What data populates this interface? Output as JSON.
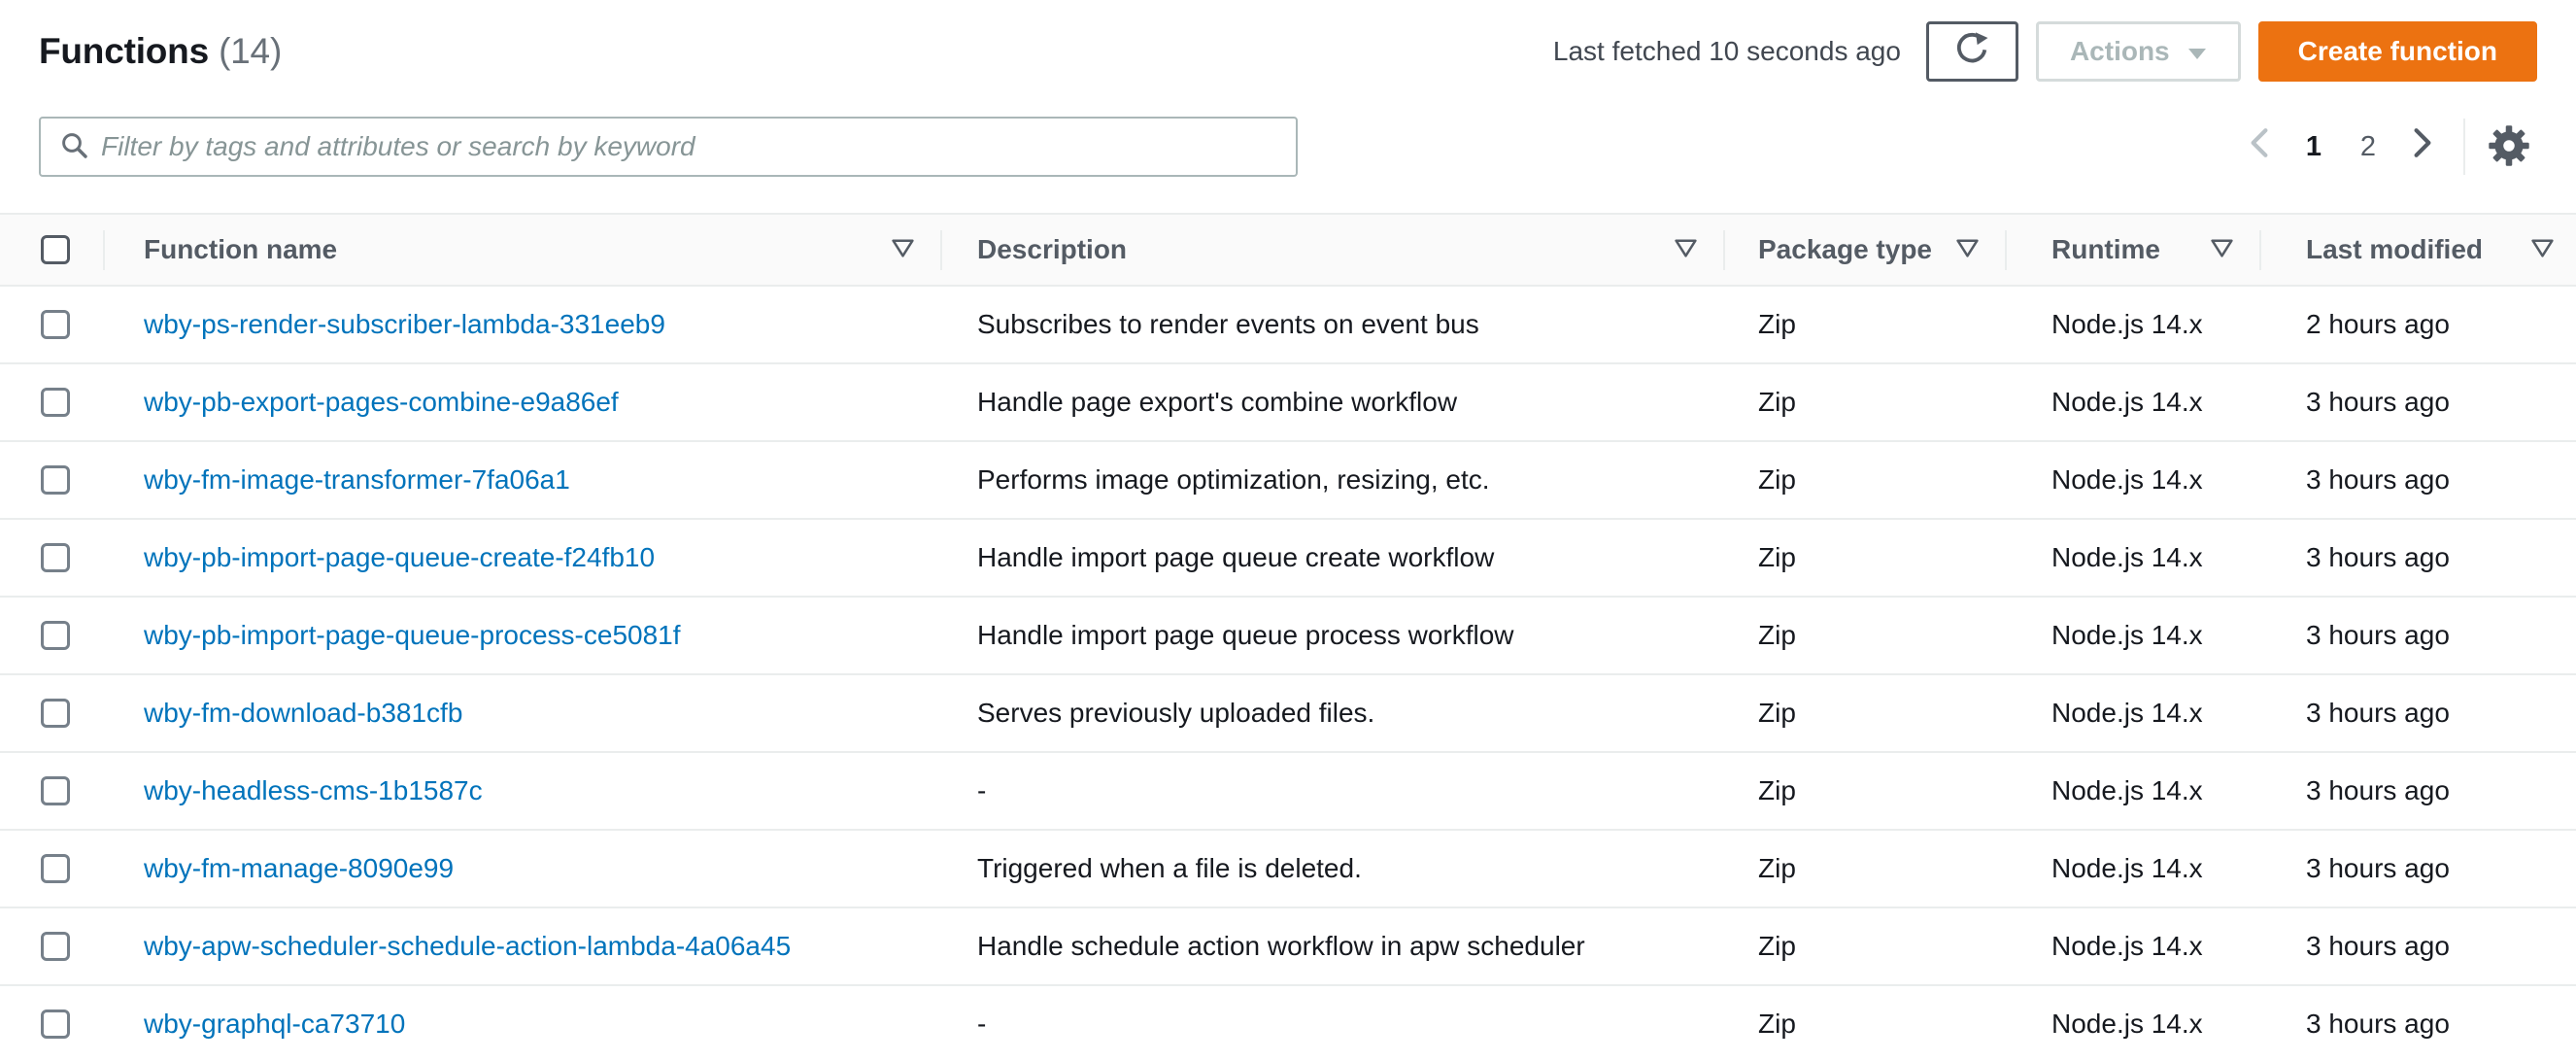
{
  "header": {
    "title": "Functions",
    "count": "(14)",
    "last_fetched": "Last fetched 10 seconds ago",
    "actions_label": "Actions",
    "create_label": "Create function"
  },
  "toolbar": {
    "search_placeholder": "Filter by tags and attributes or search by keyword",
    "pagination": {
      "prev_page": "‹",
      "page_1": "1",
      "page_2": "2",
      "next_page": "›",
      "current_page": "1"
    }
  },
  "icons": {
    "search": "magnifier",
    "refresh": "circular-arrow",
    "actions_caret": "caret-down-filled",
    "column_filter": "triangle-down-outline",
    "prev": "chevron-left",
    "next": "chevron-right",
    "settings": "gear"
  },
  "colors": {
    "accent_orange": "#ec7211",
    "link_blue": "#0073bb",
    "text_dark": "#16191f",
    "text_gray": "#687078",
    "header_text": "#545b64",
    "border_light": "#eaeded",
    "disabled_text": "#aab7b8"
  },
  "table": {
    "columns": [
      "Function name",
      "Description",
      "Package type",
      "Runtime",
      "Last modified"
    ],
    "rows": [
      {
        "name": "wby-ps-render-subscriber-lambda-331eeb9",
        "description": "Subscribes to render events on event bus",
        "package_type": "Zip",
        "runtime": "Node.js 14.x",
        "last_modified": "2 hours ago"
      },
      {
        "name": "wby-pb-export-pages-combine-e9a86ef",
        "description": "Handle page export's combine workflow",
        "package_type": "Zip",
        "runtime": "Node.js 14.x",
        "last_modified": "3 hours ago"
      },
      {
        "name": "wby-fm-image-transformer-7fa06a1",
        "description": "Performs image optimization, resizing, etc.",
        "package_type": "Zip",
        "runtime": "Node.js 14.x",
        "last_modified": "3 hours ago"
      },
      {
        "name": "wby-pb-import-page-queue-create-f24fb10",
        "description": "Handle import page queue create workflow",
        "package_type": "Zip",
        "runtime": "Node.js 14.x",
        "last_modified": "3 hours ago"
      },
      {
        "name": "wby-pb-import-page-queue-process-ce5081f",
        "description": "Handle import page queue process workflow",
        "package_type": "Zip",
        "runtime": "Node.js 14.x",
        "last_modified": "3 hours ago"
      },
      {
        "name": "wby-fm-download-b381cfb",
        "description": "Serves previously uploaded files.",
        "package_type": "Zip",
        "runtime": "Node.js 14.x",
        "last_modified": "3 hours ago"
      },
      {
        "name": "wby-headless-cms-1b1587c",
        "description": "-",
        "package_type": "Zip",
        "runtime": "Node.js 14.x",
        "last_modified": "3 hours ago"
      },
      {
        "name": "wby-fm-manage-8090e99",
        "description": "Triggered when a file is deleted.",
        "package_type": "Zip",
        "runtime": "Node.js 14.x",
        "last_modified": "3 hours ago"
      },
      {
        "name": "wby-apw-scheduler-schedule-action-lambda-4a06a45",
        "description": "Handle schedule action workflow in apw scheduler",
        "package_type": "Zip",
        "runtime": "Node.js 14.x",
        "last_modified": "3 hours ago"
      },
      {
        "name": "wby-graphql-ca73710",
        "description": "-",
        "package_type": "Zip",
        "runtime": "Node.js 14.x",
        "last_modified": "3 hours ago"
      }
    ]
  }
}
